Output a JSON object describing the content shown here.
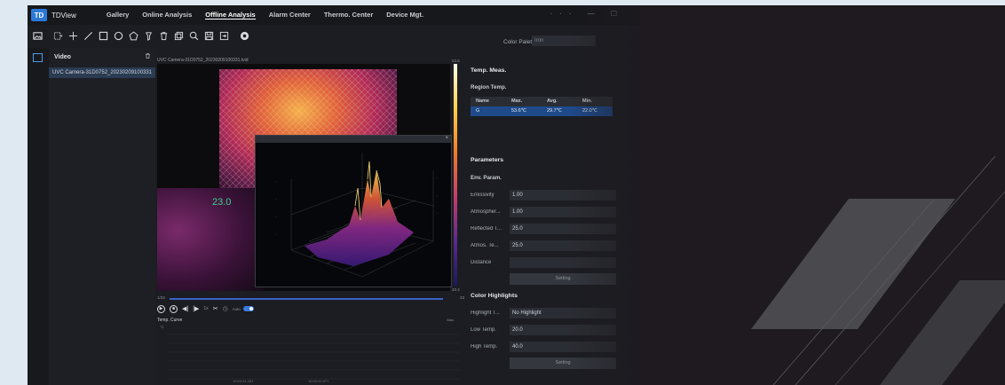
{
  "app": {
    "logo_text": "TD",
    "name": "TDView"
  },
  "menu": [
    "Gallery",
    "Online Analysis",
    "Offline Analysis",
    "Alarm Center",
    "Thermo. Center",
    "Device Mgt."
  ],
  "active_menu": "Offline Analysis",
  "window_controls": "··· — ☐",
  "toolbar": {
    "icons": [
      "image-icon",
      "rect-select-icon",
      "point-icon",
      "line-icon",
      "rectangle-icon",
      "circle-icon",
      "polygon-icon",
      "pin-icon",
      "delete-icon",
      "copy-icon",
      "zoom-icon",
      "save-icon",
      "export-icon",
      "3d-icon"
    ],
    "palette_label": "Color Palette",
    "palette_value": "Iron"
  },
  "video_panel": {
    "header": "Video",
    "file": "UVC Camera-31D0752_20230209100331"
  },
  "view": {
    "file_header": "UVC Camera-31D0752_20230209100331.tvid",
    "temp_reading": "23.0",
    "colorbar_max": "53.6",
    "colorbar_min": "20.4",
    "timeline_start": "1/33",
    "timeline_end": "33"
  },
  "playback": {
    "auto_label": "Auto"
  },
  "temp_curve": {
    "title": "Temp. Curve",
    "unit": "°C",
    "max_label": "Max.",
    "x_label_1": "10:00:01.283",
    "x_label_2": "10:00:02.871"
  },
  "right_panel": {
    "temp_meas": "Temp. Meas.",
    "region_temp": "Region Temp.",
    "table_headers": [
      "Name",
      "Max.",
      "Avg.",
      "Min."
    ],
    "table_rows": [
      [
        "G",
        "53.6℃",
        "29.7℃",
        "22.0℃"
      ]
    ],
    "parameters": "Parameters",
    "env_param": "Env. Param.",
    "fields": [
      {
        "label": "Emissivity",
        "value": "1.00"
      },
      {
        "label": "Atmospher...",
        "value": "1.00"
      },
      {
        "label": "Reflected T...",
        "value": "25.0"
      },
      {
        "label": "Atmos. Te...",
        "value": "25.0"
      },
      {
        "label": "Distance",
        "value": ""
      }
    ],
    "setting_label": "Setting",
    "color_highlights": "Color Highlights",
    "highlight_fields": [
      {
        "label": "Highlight T...",
        "value": "No Highlight"
      },
      {
        "label": "Low Temp.",
        "value": "20.0"
      },
      {
        "label": "High Temp.",
        "value": "40.0"
      }
    ]
  },
  "colors": {
    "accent": "#2a79d8",
    "selected_row": "#1f4a8a",
    "timeline": "#3a62c8",
    "background": "#1e1a20"
  }
}
